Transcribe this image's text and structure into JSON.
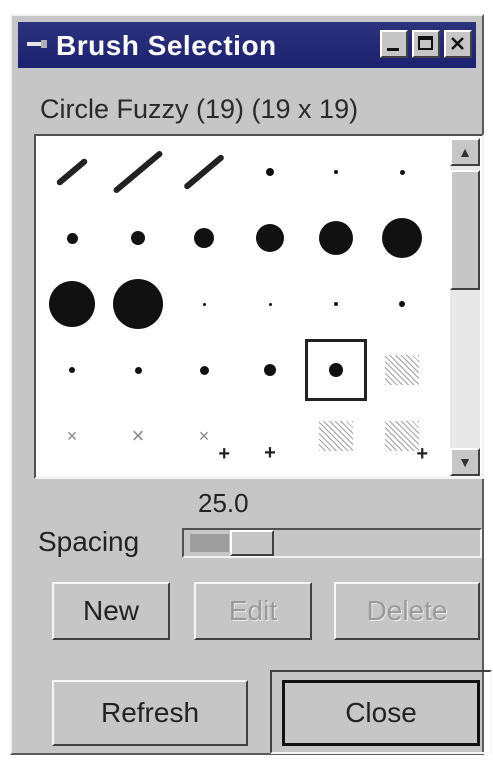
{
  "window": {
    "title": "Brush Selection",
    "brush_name": "Circle Fuzzy (19) (19 x 19)"
  },
  "brushes": [
    {
      "row": 0,
      "col": 0,
      "kind": "line",
      "size": 38
    },
    {
      "row": 0,
      "col": 1,
      "kind": "line",
      "size": 62
    },
    {
      "row": 0,
      "col": 2,
      "kind": "line",
      "size": 50
    },
    {
      "row": 0,
      "col": 3,
      "kind": "dot",
      "size": 8
    },
    {
      "row": 0,
      "col": 4,
      "kind": "dot",
      "size": 4
    },
    {
      "row": 0,
      "col": 5,
      "kind": "dot",
      "size": 5
    },
    {
      "row": 1,
      "col": 0,
      "kind": "dot",
      "size": 11
    },
    {
      "row": 1,
      "col": 1,
      "kind": "dot",
      "size": 14
    },
    {
      "row": 1,
      "col": 2,
      "kind": "dot",
      "size": 20
    },
    {
      "row": 1,
      "col": 3,
      "kind": "dot",
      "size": 28
    },
    {
      "row": 1,
      "col": 4,
      "kind": "dot",
      "size": 34
    },
    {
      "row": 1,
      "col": 5,
      "kind": "dot",
      "size": 40
    },
    {
      "row": 2,
      "col": 0,
      "kind": "dot",
      "size": 46
    },
    {
      "row": 2,
      "col": 1,
      "kind": "dot",
      "size": 50
    },
    {
      "row": 2,
      "col": 2,
      "kind": "dot",
      "size": 3
    },
    {
      "row": 2,
      "col": 3,
      "kind": "dot",
      "size": 3
    },
    {
      "row": 2,
      "col": 4,
      "kind": "dot",
      "size": 4
    },
    {
      "row": 2,
      "col": 5,
      "kind": "dot",
      "size": 6
    },
    {
      "row": 3,
      "col": 0,
      "kind": "dot",
      "size": 6
    },
    {
      "row": 3,
      "col": 1,
      "kind": "dot",
      "size": 7
    },
    {
      "row": 3,
      "col": 2,
      "kind": "dot",
      "size": 9
    },
    {
      "row": 3,
      "col": 3,
      "kind": "dot",
      "size": 12
    },
    {
      "row": 3,
      "col": 4,
      "kind": "selected",
      "size": 14
    },
    {
      "row": 3,
      "col": 5,
      "kind": "texture",
      "size": 10
    },
    {
      "row": 4,
      "col": 0,
      "kind": "x",
      "size": 10
    },
    {
      "row": 4,
      "col": 1,
      "kind": "x",
      "size": 14
    },
    {
      "row": 4,
      "col": 2,
      "kind": "x-plus",
      "size": 10
    },
    {
      "row": 4,
      "col": 3,
      "kind": "plus",
      "size": 10
    },
    {
      "row": 4,
      "col": 4,
      "kind": "texture",
      "size": 10
    },
    {
      "row": 4,
      "col": 5,
      "kind": "texture-plus",
      "size": 10
    }
  ],
  "spacing": {
    "label": "Spacing",
    "value": "25.0",
    "level_percent": 25
  },
  "buttons": {
    "new": "New",
    "edit": "Edit",
    "delete": "Delete",
    "refresh": "Refresh",
    "close": "Close"
  },
  "icons": {
    "window": "brush-window-icon",
    "minimize": "minimize-icon",
    "maximize": "maximize-icon",
    "close": "close-icon",
    "scroll_up": "scroll-up-arrow-icon",
    "scroll_down": "scroll-down-arrow-icon"
  },
  "colors": {
    "titlebar": "#1f2472",
    "window_bg": "#c6c6c6",
    "grid_bg": "#ffffff"
  }
}
